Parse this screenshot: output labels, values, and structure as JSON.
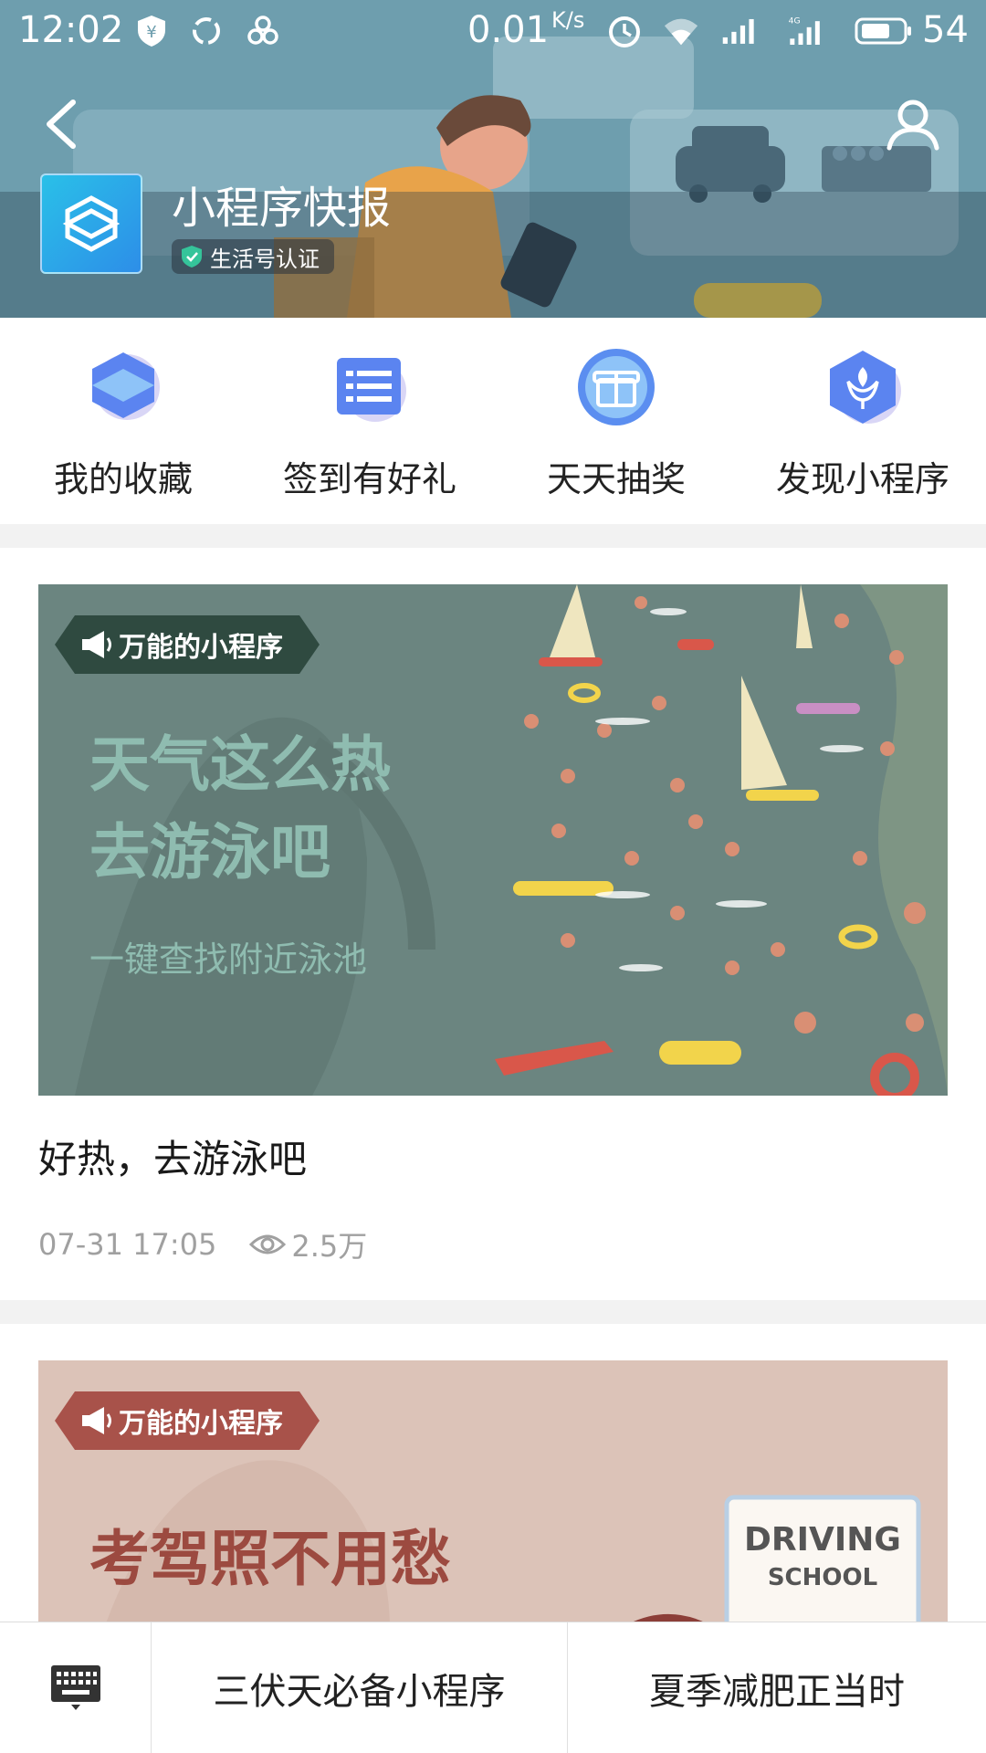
{
  "status_bar": {
    "time": "12:02",
    "speed": "0.01",
    "speed_unit": "K/s",
    "network": "4G",
    "battery": "54",
    "icons": [
      "yen-shield-icon",
      "sync-icon",
      "paw-icon",
      "alarm-icon",
      "wifi-icon",
      "signal-icon",
      "signal-4g-icon",
      "battery-icon"
    ]
  },
  "header": {
    "title": "小程序快报",
    "badge": "生活号认证",
    "back_icon": "chevron-left-icon",
    "profile_icon": "user-icon"
  },
  "shortcuts": [
    {
      "label": "我的收藏",
      "icon": "favorites-icon"
    },
    {
      "label": "签到有好礼",
      "icon": "checkin-icon"
    },
    {
      "label": "天天抽奖",
      "icon": "gift-icon"
    },
    {
      "label": "发现小程序",
      "icon": "discover-icon"
    }
  ],
  "articles": [
    {
      "banner_tag": "万能的小程序",
      "banner_headline_1": "天气这么热",
      "banner_headline_2": "去游泳吧",
      "banner_subline": "一键查找附近泳池",
      "title": "好热，去游泳吧",
      "date": "07-31 17:05",
      "views": "2.5万"
    },
    {
      "banner_tag": "万能的小程序",
      "banner_headline_1": "考驾照不用愁",
      "sign_line1": "DRIVING",
      "sign_line2": "SCHOOL"
    }
  ],
  "bottom_bar": {
    "keyboard_icon": "keyboard-icon",
    "menu": [
      "三伏天必备小程序",
      "夏季减肥正当时"
    ]
  },
  "colors": {
    "card1_bg": "#6b8580",
    "card1_tag": "#2f4a40",
    "card1_text": "#8fbcb0",
    "card2_bg": "#dcc3b8",
    "card2_tag": "#a8524a",
    "card2_text": "#9c4a40"
  }
}
